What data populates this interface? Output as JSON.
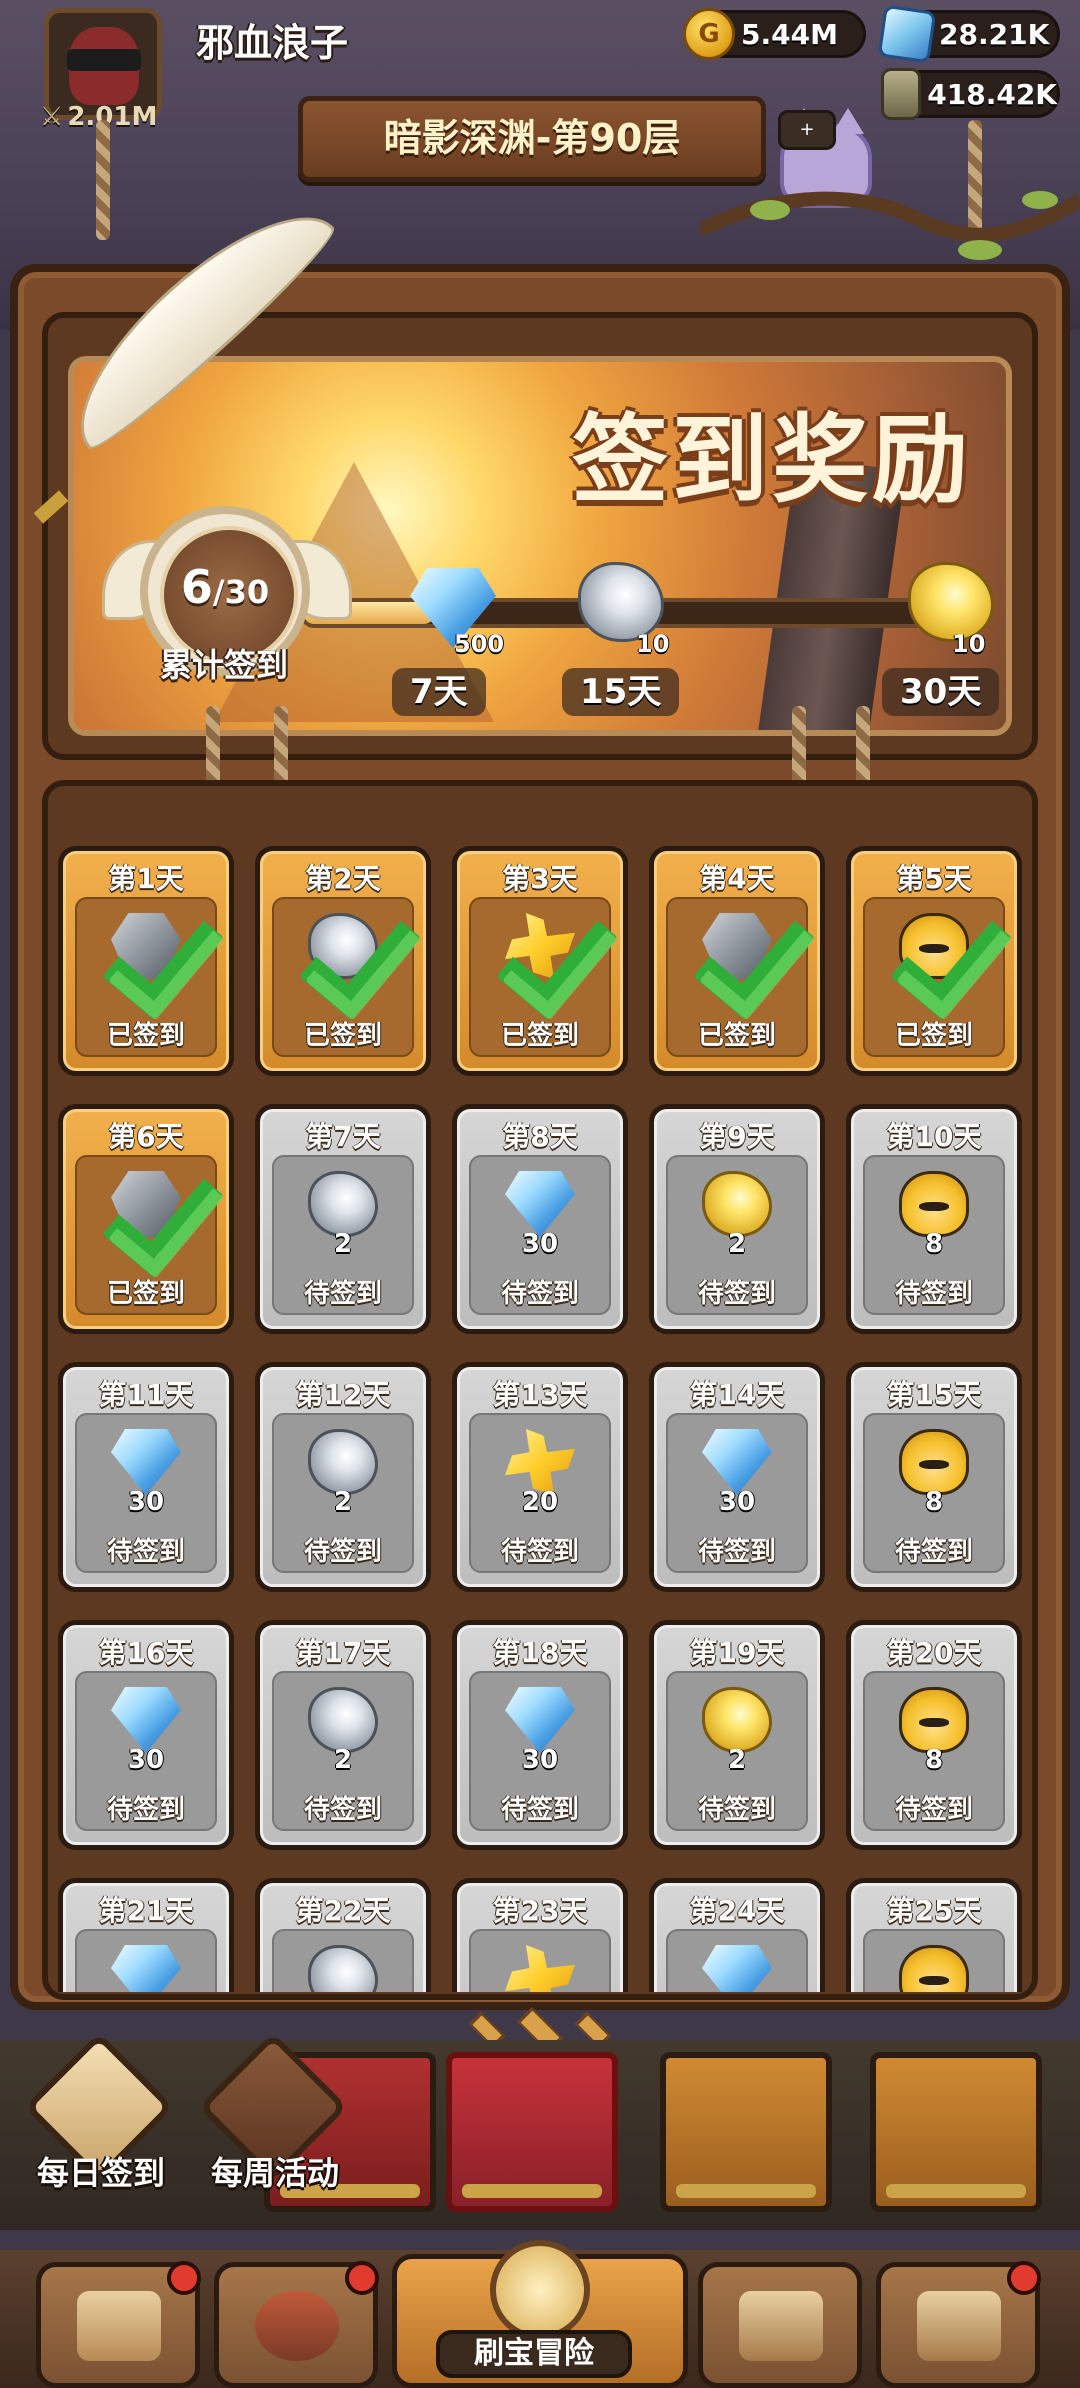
{
  "header": {
    "player_name": "邪血浪子",
    "power": "2.01M",
    "gold": "5.44M",
    "gems": "28.21K",
    "potion": "418.42K",
    "stage": "暗影深渊-第90层",
    "cat_button": "+"
  },
  "checkin": {
    "title": "签到奖励",
    "progress_current": "6",
    "progress_total": "/30",
    "progress_fraction": 0.2,
    "progress_label": "累计签到",
    "milestones": [
      {
        "count": "500",
        "day": "7天",
        "item": "gem-icon"
      },
      {
        "count": "10",
        "day": "15天",
        "item": "silver-scroll-icon"
      },
      {
        "count": "10",
        "day": "30天",
        "item": "gold-scroll-icon"
      }
    ]
  },
  "days": [
    {
      "label": "第1天",
      "qty": "",
      "status": "已签到",
      "state": "done",
      "item": "gray-ore"
    },
    {
      "label": "第2天",
      "qty": "",
      "status": "已签到",
      "state": "done",
      "item": "scroll-silver"
    },
    {
      "label": "第3天",
      "qty": "",
      "status": "已签到",
      "state": "done",
      "item": "puzzle"
    },
    {
      "label": "第4天",
      "qty": "",
      "status": "已签到",
      "state": "done",
      "item": "gray-ore"
    },
    {
      "label": "第5天",
      "qty": "",
      "status": "已签到",
      "state": "done",
      "item": "hero-face"
    },
    {
      "label": "第6天",
      "qty": "",
      "status": "已签到",
      "state": "done",
      "item": "gray-ore"
    },
    {
      "label": "第7天",
      "qty": "2",
      "status": "待签到",
      "state": "pending",
      "item": "scroll-silver"
    },
    {
      "label": "第8天",
      "qty": "30",
      "status": "待签到",
      "state": "pending",
      "item": "gem-shape"
    },
    {
      "label": "第9天",
      "qty": "2",
      "status": "待签到",
      "state": "pending",
      "item": "scroll-gold"
    },
    {
      "label": "第10天",
      "qty": "8",
      "status": "待签到",
      "state": "pending",
      "item": "hero-face"
    },
    {
      "label": "第11天",
      "qty": "30",
      "status": "待签到",
      "state": "pending",
      "item": "gem-shape"
    },
    {
      "label": "第12天",
      "qty": "2",
      "status": "待签到",
      "state": "pending",
      "item": "scroll-silver"
    },
    {
      "label": "第13天",
      "qty": "20",
      "status": "待签到",
      "state": "pending",
      "item": "puzzle"
    },
    {
      "label": "第14天",
      "qty": "30",
      "status": "待签到",
      "state": "pending",
      "item": "gem-shape"
    },
    {
      "label": "第15天",
      "qty": "8",
      "status": "待签到",
      "state": "pending",
      "item": "hero-face"
    },
    {
      "label": "第16天",
      "qty": "30",
      "status": "待签到",
      "state": "pending",
      "item": "gem-shape"
    },
    {
      "label": "第17天",
      "qty": "2",
      "status": "待签到",
      "state": "pending",
      "item": "scroll-silver"
    },
    {
      "label": "第18天",
      "qty": "30",
      "status": "待签到",
      "state": "pending",
      "item": "gem-shape"
    },
    {
      "label": "第19天",
      "qty": "2",
      "status": "待签到",
      "state": "pending",
      "item": "scroll-gold"
    },
    {
      "label": "第20天",
      "qty": "8",
      "status": "待签到",
      "state": "pending",
      "item": "hero-face"
    },
    {
      "label": "第21天",
      "qty": "",
      "status": "",
      "state": "pending",
      "item": "gem-shape"
    },
    {
      "label": "第22天",
      "qty": "",
      "status": "",
      "state": "pending",
      "item": "scroll-silver"
    },
    {
      "label": "第23天",
      "qty": "",
      "status": "",
      "state": "pending",
      "item": "puzzle"
    },
    {
      "label": "第24天",
      "qty": "",
      "status": "",
      "state": "pending",
      "item": "gem-shape"
    },
    {
      "label": "第25天",
      "qty": "",
      "status": "",
      "state": "pending",
      "item": "hero-face"
    }
  ],
  "shortcuts": [
    {
      "label": "每日签到"
    },
    {
      "label": "每周活动"
    }
  ],
  "nav": {
    "active_label": "刷宝冒险"
  },
  "colors": {
    "done": "#e39b3a",
    "pending": "#c9c9c9",
    "check": "#2fae3a"
  }
}
